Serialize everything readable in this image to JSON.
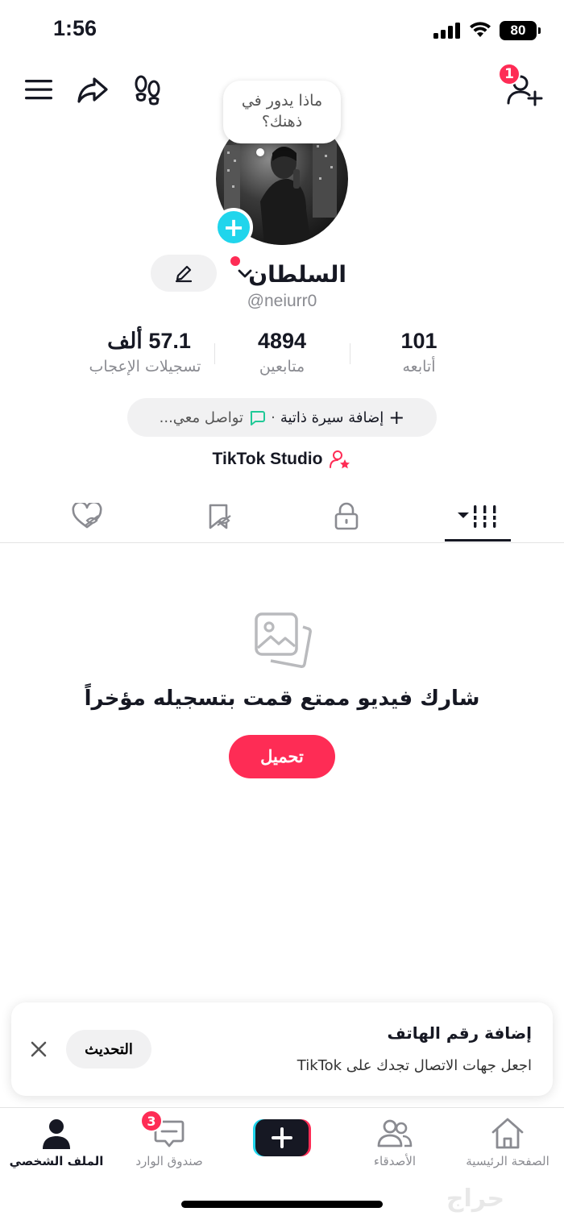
{
  "status_bar": {
    "time": "1:56",
    "battery": "80"
  },
  "top_bar": {
    "notification_count": "1"
  },
  "profile": {
    "thought_bubble": "ماذا يدور في ذهنك؟",
    "display_name": "السلطان",
    "username": "@neiurr0"
  },
  "stats": {
    "likes": {
      "value": "57.1 ألف",
      "label": "تسجيلات الإعجاب"
    },
    "followers": {
      "value": "4894",
      "label": "متابعين"
    },
    "following": {
      "value": "101",
      "label": "أتابعه"
    }
  },
  "bio": {
    "add_label": "إضافة سيرة ذاتية",
    "separator": "·",
    "contact_label": "تواصل معي..."
  },
  "studio": {
    "label": "TikTok Studio"
  },
  "empty_state": {
    "title": "شارك فيديو ممتع قمت بتسجيله مؤخراً",
    "button_label": "تحميل"
  },
  "phone_prompt": {
    "title": "إضافة رقم الهاتف",
    "subtitle": "اجعل جهات الاتصال تجدك على TikTok",
    "button_label": "التحديث"
  },
  "bottom_nav": {
    "home": "الصفحة الرئيسية",
    "friends": "الأصدقاء",
    "inbox": "صندوق الوارد",
    "inbox_badge": "3",
    "profile": "الملف الشخصي"
  },
  "watermark": "حراج",
  "colors": {
    "accent": "#fe2c55",
    "cyan": "#20d5ec",
    "text": "#161823",
    "muted": "#8a8b91"
  }
}
